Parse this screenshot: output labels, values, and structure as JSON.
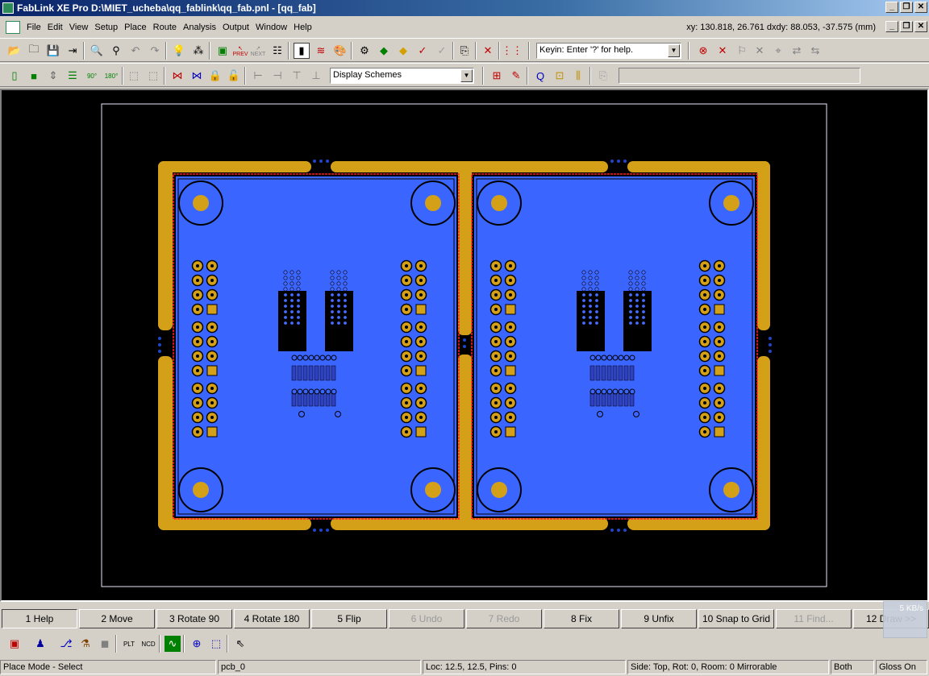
{
  "window": {
    "app_name": "FabLink XE Pro",
    "title": "FabLink XE Pro  D:\\MIET_ucheba\\qq_fablink\\qq_fab.pnl - [qq_fab]",
    "minimize": "_",
    "maximize": "❐",
    "close": "✕"
  },
  "menu": {
    "items": [
      "File",
      "Edit",
      "View",
      "Setup",
      "Place",
      "Route",
      "Analysis",
      "Output",
      "Window",
      "Help"
    ],
    "coords": "xy: 130.818, 26.761   dxdy: 88.053, -37.575  (mm)"
  },
  "toolbar1": {
    "prev_label": "PREV",
    "next_label": "NEXT",
    "keyin_value": "Keyin: Enter '?' for help."
  },
  "toolbar2": {
    "display_schemes": "Display Schemes"
  },
  "fkeys": [
    {
      "label": "1 Help",
      "enabled": true
    },
    {
      "label": "2 Move",
      "enabled": true
    },
    {
      "label": "3 Rotate 90",
      "enabled": true
    },
    {
      "label": "4 Rotate 180",
      "enabled": true
    },
    {
      "label": "5 Flip",
      "enabled": true
    },
    {
      "label": "6 Undo",
      "enabled": false
    },
    {
      "label": "7 Redo",
      "enabled": false
    },
    {
      "label": "8 Fix",
      "enabled": true
    },
    {
      "label": "9 Unfix",
      "enabled": true
    },
    {
      "label": "10 Snap to Grid",
      "enabled": true
    },
    {
      "label": "11 Find...",
      "enabled": false
    },
    {
      "label": "12 Draw >>",
      "enabled": true
    }
  ],
  "network_widget": "5 KB/s",
  "statusbar": {
    "mode": "Place Mode - Select",
    "pcb": "pcb_0",
    "loc": "Loc: 12.5, 12.5, Pins: 0",
    "side": "Side: Top, Rot: 0, Room: 0  Mirrorable",
    "layer": "Both",
    "gloss": "Gloss On"
  },
  "colors": {
    "canvas": "#000000",
    "copper_pour": "#3a66ff",
    "rail": "#d4a017",
    "pad": "#d4a017",
    "outline": "#e0e0ff",
    "selected": "#ff2020"
  }
}
